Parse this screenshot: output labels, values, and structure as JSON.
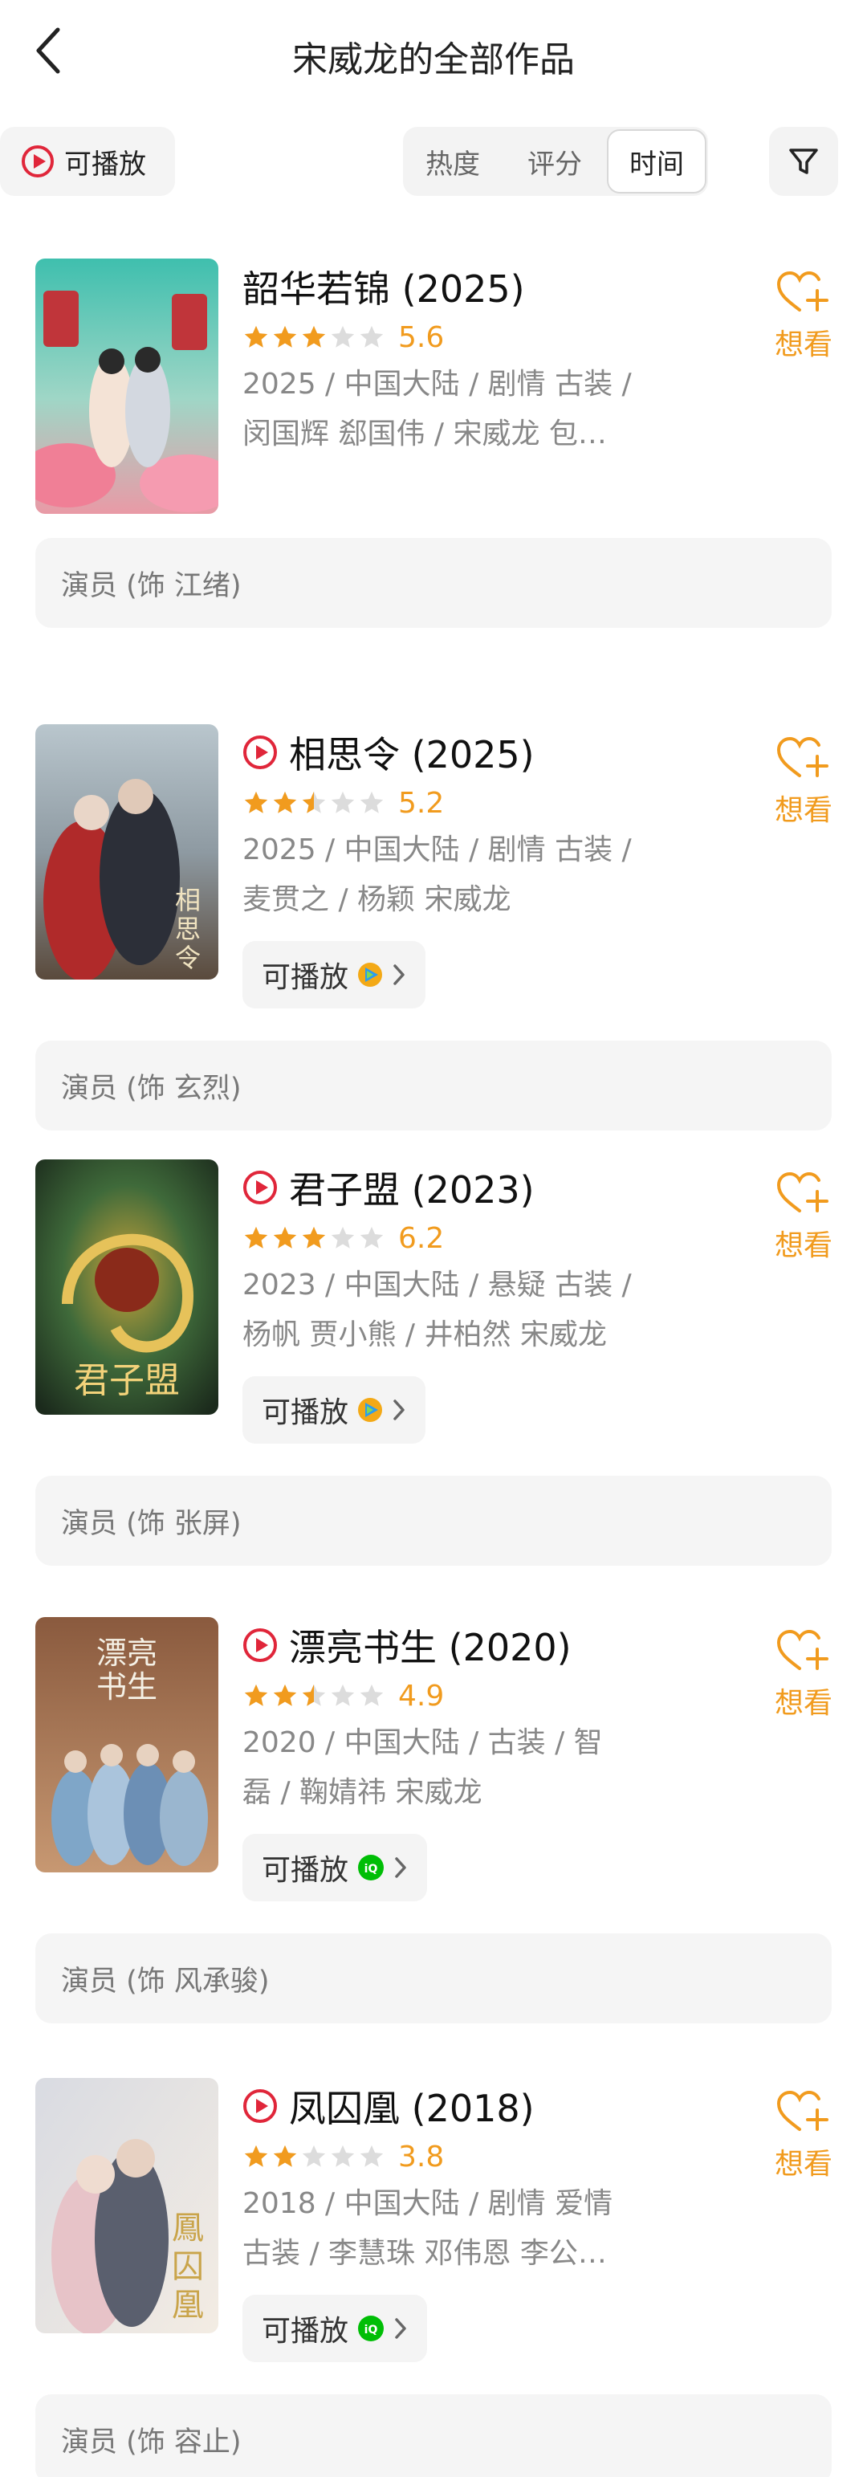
{
  "header": {
    "title": "宋威龙的全部作品"
  },
  "filter": {
    "playable_label": "可播放",
    "sort_tabs": [
      "热度",
      "评分",
      "时间"
    ],
    "active_sort": "时间"
  },
  "colors": {
    "accent": "#f19b1e",
    "play_red": "#e0263a",
    "tencent_blue": "#2a9cf0",
    "iqiyi_green": "#00be06",
    "chip_bg": "#f4f4f4"
  },
  "items": [
    {
      "title": "韶华若锦 (2025)",
      "playable_icon": false,
      "stars": 3,
      "score": "5.6",
      "meta_line1": "2025 / 中国大陆 / 剧情 古装 /",
      "meta_line2": "闵国辉 郄国伟 / 宋威龙 包…",
      "play_label": null,
      "platform": null,
      "want": "想看",
      "role": "演员 (饰 江绪)"
    },
    {
      "title": "相思令 (2025)",
      "playable_icon": true,
      "stars": 2.5,
      "score": "5.2",
      "meta_line1": "2025 / 中国大陆 / 剧情 古装 /",
      "meta_line2": "麦贯之 / 杨颖 宋威龙",
      "play_label": "可播放",
      "platform": "tencent-video",
      "want": "想看",
      "role": "演员 (饰 玄烈)"
    },
    {
      "title": "君子盟 (2023)",
      "playable_icon": true,
      "stars": 3,
      "score": "6.2",
      "meta_line1": "2023 / 中国大陆 / 悬疑 古装 /",
      "meta_line2": "杨帆 贾小熊 / 井柏然 宋威龙",
      "play_label": "可播放",
      "platform": "tencent-video",
      "want": "想看",
      "role": "演员 (饰 张屏)"
    },
    {
      "title": "漂亮书生 (2020)",
      "playable_icon": true,
      "stars": 2.5,
      "score": "4.9",
      "meta_line1": "2020 / 中国大陆 / 古装 / 智",
      "meta_line2": "磊 / 鞠婧祎 宋威龙",
      "play_label": "可播放",
      "platform": "iqiyi",
      "want": "想看",
      "role": "演员 (饰 风承骏)"
    },
    {
      "title": "凤囚凰 (2018)",
      "playable_icon": true,
      "stars": 2,
      "score": "3.8",
      "meta_line1": "2018 / 中国大陆 / 剧情 爱情",
      "meta_line2": "古装 / 李慧珠 邓伟恩 李公…",
      "play_label": "可播放",
      "platform": "iqiyi",
      "want": "想看",
      "role": "演员 (饰 容止)"
    }
  ]
}
